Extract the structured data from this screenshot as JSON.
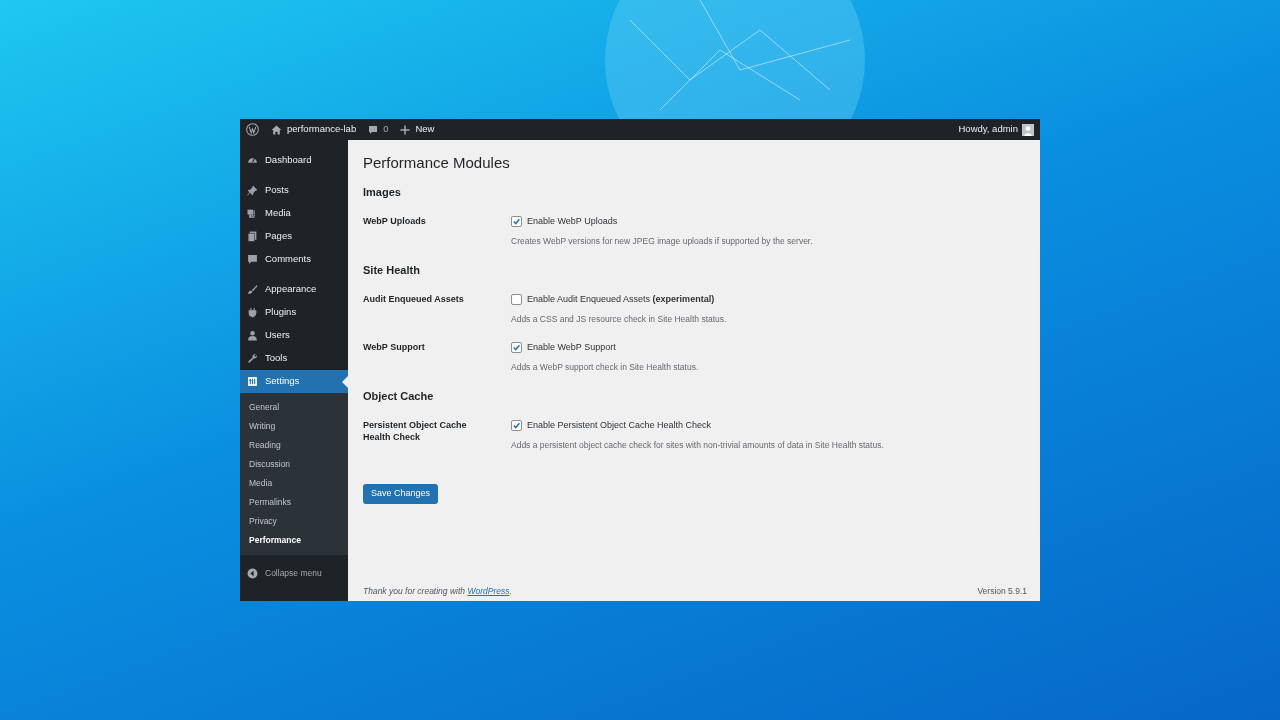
{
  "admin_bar": {
    "site": "performance-lab",
    "comments": "0",
    "new": "New",
    "greeting": "Howdy, admin"
  },
  "menu_groups": [
    [
      {
        "label": "Dashboard",
        "selected": false
      }
    ],
    [
      {
        "label": "Posts",
        "selected": false
      },
      {
        "label": "Media",
        "selected": false
      },
      {
        "label": "Pages",
        "selected": false
      },
      {
        "label": "Comments",
        "selected": false
      }
    ],
    [
      {
        "label": "Appearance",
        "selected": false
      },
      {
        "label": "Plugins",
        "selected": false
      },
      {
        "label": "Users",
        "selected": false
      },
      {
        "label": "Tools",
        "selected": false
      },
      {
        "label": "Settings",
        "selected": true,
        "submenu": [
          {
            "label": "General",
            "selected": false
          },
          {
            "label": "Writing",
            "selected": false
          },
          {
            "label": "Reading",
            "selected": false
          },
          {
            "label": "Discussion",
            "selected": false
          },
          {
            "label": "Media",
            "selected": false
          },
          {
            "label": "Permalinks",
            "selected": false
          },
          {
            "label": "Privacy",
            "selected": false
          },
          {
            "label": "Performance",
            "selected": true
          }
        ]
      }
    ]
  ],
  "collapse_menu": "Collapse menu",
  "title": "Performance Modules",
  "sections": [
    {
      "heading": "Images",
      "rows": [
        {
          "label": "WebP Uploads",
          "checkbox_label": "Enable WebP Uploads",
          "checked": true,
          "description": "Creates WebP versions for new JPEG image uploads if supported by the server."
        }
      ]
    },
    {
      "heading": "Site Health",
      "rows": [
        {
          "label": "Audit Enqueued Assets",
          "checkbox_label": "Enable Audit Enqueued Assets **(experimental)**",
          "checked": false,
          "description": "Adds a CSS and JS resource check in Site Health status."
        },
        {
          "label": "WebP Support",
          "checkbox_label": "Enable WebP Support",
          "checked": true,
          "description": "Adds a WebP support check in Site Health status."
        }
      ]
    },
    {
      "heading": "Object Cache",
      "rows": [
        {
          "label": "Persistent Object Cache Health Check",
          "checkbox_label": "Enable Persistent Object Cache Health Check",
          "checked": true,
          "description": "Adds a persistent object cache check for sites with non-trivial amounts of data in Site Health status."
        }
      ]
    }
  ],
  "save_button": "Save Changes",
  "footer": {
    "text_before": "Thank you for creating with ",
    "link": "WordPress",
    "text_after": ".",
    "version": "Version 5.9.1"
  }
}
